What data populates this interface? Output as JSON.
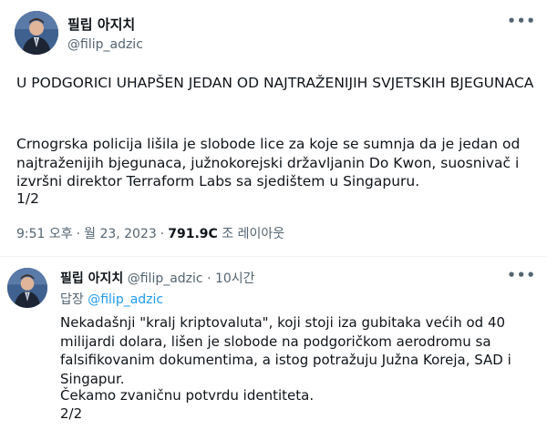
{
  "tweet": {
    "author_name": "필립 아지치",
    "author_handle": "@filip_adzic",
    "more_icon": "•••",
    "headline": "U PODGORICI UHAPŠEN JEDAN OD NAJTRAŽENIJIH SVJETSKIH BJEGUNACA",
    "body": "Crnogrska policija lišila je slobode lice za koje se sumnja da je jedan od najtraženijih bjegunaca, južnokorejski državljanin Do Kwon, suosnivač i izvršni direktor Terraform Labs sa sjedištem u Singapuru.",
    "page_marker": "1/2",
    "time": "9:51 오후",
    "date": "월 23, 2023",
    "views_count": "791.9C",
    "views_label": "조 레이아웃",
    "separator": "·"
  },
  "reply": {
    "author_name": "필립 아지치",
    "author_handle": "@filip_adzic",
    "separator": "·",
    "time_ago": "10시간",
    "more_icon": "•••",
    "replying_label": "답장",
    "replying_to": "@filip_adzic",
    "body": "Nekadašnji \"kralj kriptovaluta\", koji stoji iza gubitaka većih od 40 milijardi dolara, lišen je slobode na podgoričkom aerodromu sa falsifikovanim dokumentima, a istog potražuju Južna Koreja, SAD i Singapur.",
    "body2": "Čekamo zvaničnu potvrdu identiteta.",
    "page_marker": "2/2"
  }
}
